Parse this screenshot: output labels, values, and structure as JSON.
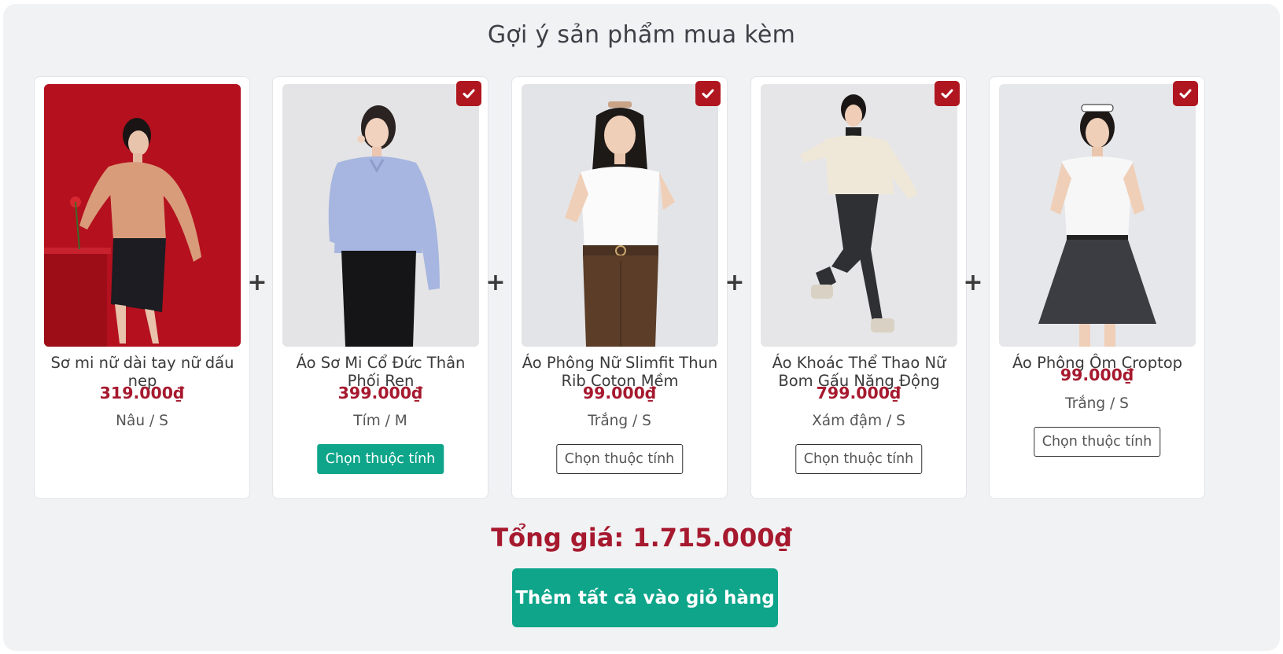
{
  "section_title": "Gợi ý sản phẩm mua kèm",
  "plus_sign": "+",
  "products": [
    {
      "name": "Sơ mi nữ dài tay nữ dấu nẹp",
      "price": "319.000₫",
      "variant": "Nâu / S",
      "checked": false,
      "button_label": ""
    },
    {
      "name": "Áo Sơ Mi Cổ Đức Thân Phối Ren",
      "price": "399.000₫",
      "variant": "Tím / M",
      "checked": true,
      "button_label": "Chọn thuộc tính"
    },
    {
      "name": "Áo Phông Nữ Slimfit Thun Rib Coton Mềm",
      "price": "99.000₫",
      "variant": "Trắng / S",
      "checked": true,
      "button_label": "Chọn thuộc tính"
    },
    {
      "name": "Áo Khoác Thể Thao Nữ Bom Gấu Năng Động",
      "price": "799.000₫",
      "variant": "Xám đậm / S",
      "checked": true,
      "button_label": "Chọn thuộc tính"
    },
    {
      "name": "Áo Phông Ôm Croptop",
      "price": "99.000₫",
      "variant": "Trắng / S",
      "checked": true,
      "button_label": "Chọn thuộc tính"
    }
  ],
  "total_label": "Tổng giá: 1.715.000₫",
  "add_all_label": "Thêm tất cả vào giỏ hàng",
  "colors": {
    "accent_green": "#0ea58a",
    "price_red": "#a6192e",
    "check_red": "#b0161f",
    "panel_bg": "#f1f2f4"
  }
}
